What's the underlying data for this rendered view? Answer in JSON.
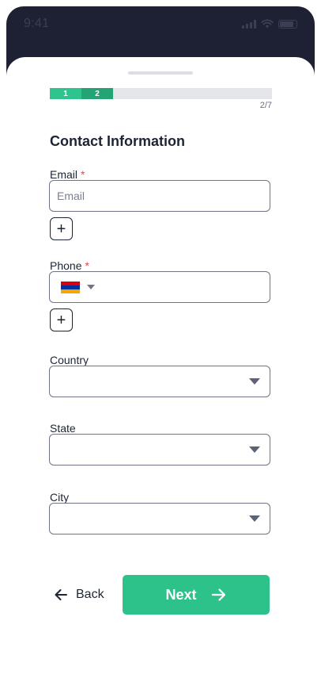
{
  "status_bar": {
    "time": "9:41"
  },
  "stepper": {
    "steps": [
      "1",
      "2"
    ],
    "count": "2/7",
    "current": 2,
    "total": 7
  },
  "form": {
    "title": "Contact Information",
    "email": {
      "label": "Email",
      "required_mark": "*",
      "placeholder": "Email",
      "value": ""
    },
    "phone": {
      "label": "Phone",
      "required_mark": "*",
      "country_flag": "armenia-flag",
      "value": ""
    },
    "add_icon": "+",
    "country": {
      "label": "Country",
      "value": ""
    },
    "state": {
      "label": "State",
      "value": ""
    },
    "city": {
      "label": "City",
      "value": ""
    }
  },
  "footer": {
    "back_label": "Back",
    "next_label": "Next"
  },
  "colors": {
    "accent": "#2ec28b",
    "accent_dark": "#24a375",
    "header_bg": "#1e2133",
    "required": "#e5484d"
  }
}
